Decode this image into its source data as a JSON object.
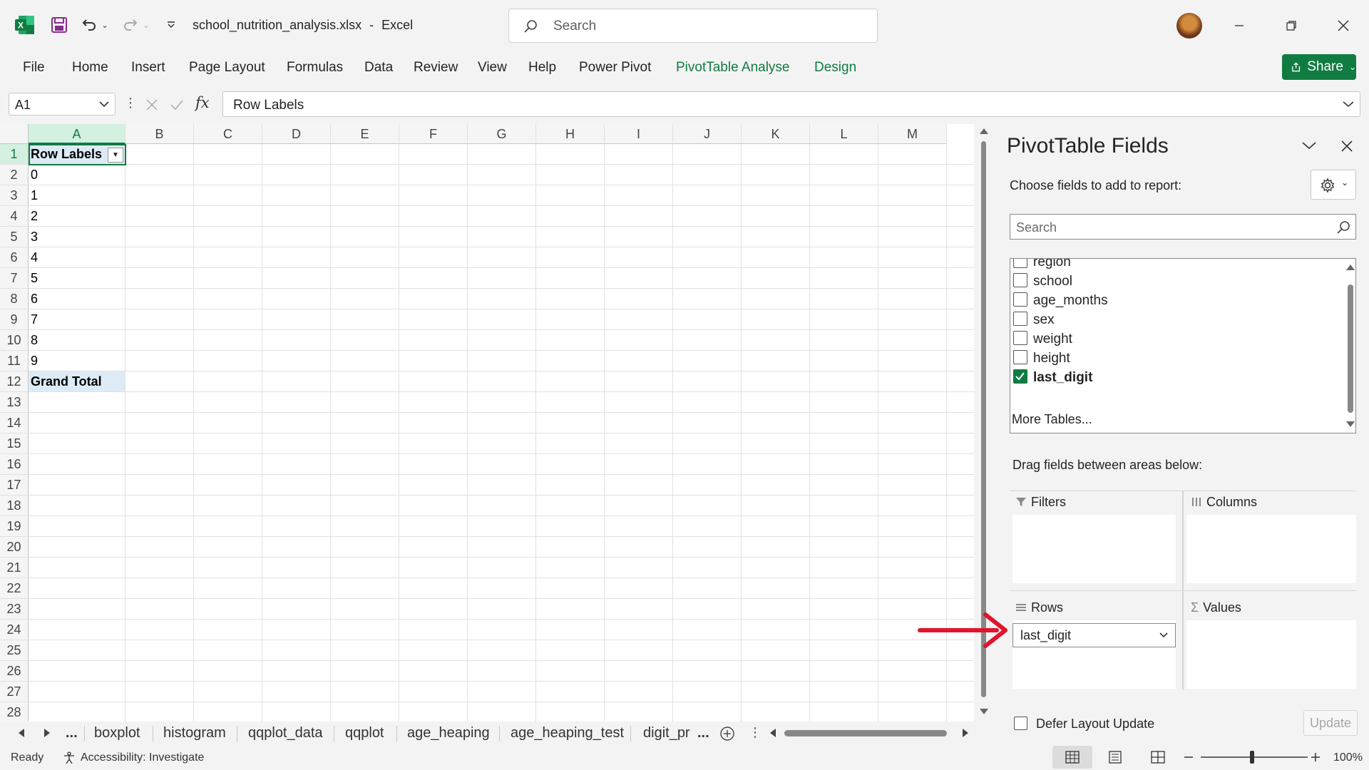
{
  "app": {
    "filename": "school_nutrition_analysis.xlsx",
    "separator": "-",
    "app_name": "Excel",
    "search_placeholder": "Search"
  },
  "menu": {
    "items": [
      "File",
      "Home",
      "Insert",
      "Page Layout",
      "Formulas",
      "Data",
      "Review",
      "View",
      "Help",
      "Power Pivot"
    ],
    "context_items": [
      "PivotTable Analyse",
      "Design"
    ],
    "share_label": "Share"
  },
  "formula_bar": {
    "name_box": "A1",
    "formula": "Row Labels",
    "fx_symbol": "fx"
  },
  "grid": {
    "columns": [
      "A",
      "B",
      "C",
      "D",
      "E",
      "F",
      "G",
      "H",
      "I",
      "J",
      "K",
      "L",
      "M"
    ],
    "rows": [
      "1",
      "2",
      "3",
      "4",
      "5",
      "6",
      "7",
      "8",
      "9",
      "10",
      "11",
      "12",
      "13",
      "14",
      "15",
      "16",
      "17",
      "18",
      "19",
      "20",
      "21",
      "22",
      "23",
      "24",
      "25",
      "26",
      "27",
      "28"
    ],
    "pivot_header": "Row Labels",
    "pivot_values": [
      "0",
      "1",
      "2",
      "3",
      "4",
      "5",
      "6",
      "7",
      "8",
      "9"
    ],
    "grand_total": "Grand Total"
  },
  "sheet_tabs": {
    "ellipsis_left": "...",
    "tabs": [
      "boxplot",
      "histogram",
      "qqplot_data",
      "qqplot",
      "age_heaping",
      "age_heaping_test",
      "digit_pr"
    ],
    "ellipsis_right": "..."
  },
  "status": {
    "ready": "Ready",
    "accessibility": "Accessibility: Investigate",
    "zoom": "100%"
  },
  "pivot_pane": {
    "title": "PivotTable Fields",
    "subtitle": "Choose fields to add to report:",
    "search_placeholder": "Search",
    "fields": [
      {
        "label": "region",
        "checked": false
      },
      {
        "label": "school",
        "checked": false
      },
      {
        "label": "age_months",
        "checked": false
      },
      {
        "label": "sex",
        "checked": false
      },
      {
        "label": "weight",
        "checked": false
      },
      {
        "label": "height",
        "checked": false
      },
      {
        "label": "last_digit",
        "checked": true
      }
    ],
    "more_tables": "More Tables...",
    "drag_label": "Drag fields between areas below:",
    "areas": {
      "filters": "Filters",
      "columns": "Columns",
      "rows": "Rows",
      "values": "Values"
    },
    "rows_field": "last_digit",
    "defer_label": "Defer Layout Update",
    "update_label": "Update"
  },
  "colors": {
    "excel_green": "#107c41",
    "pivot_highlight": "#ddebf7",
    "annotation_arrow": "#e0142c"
  }
}
